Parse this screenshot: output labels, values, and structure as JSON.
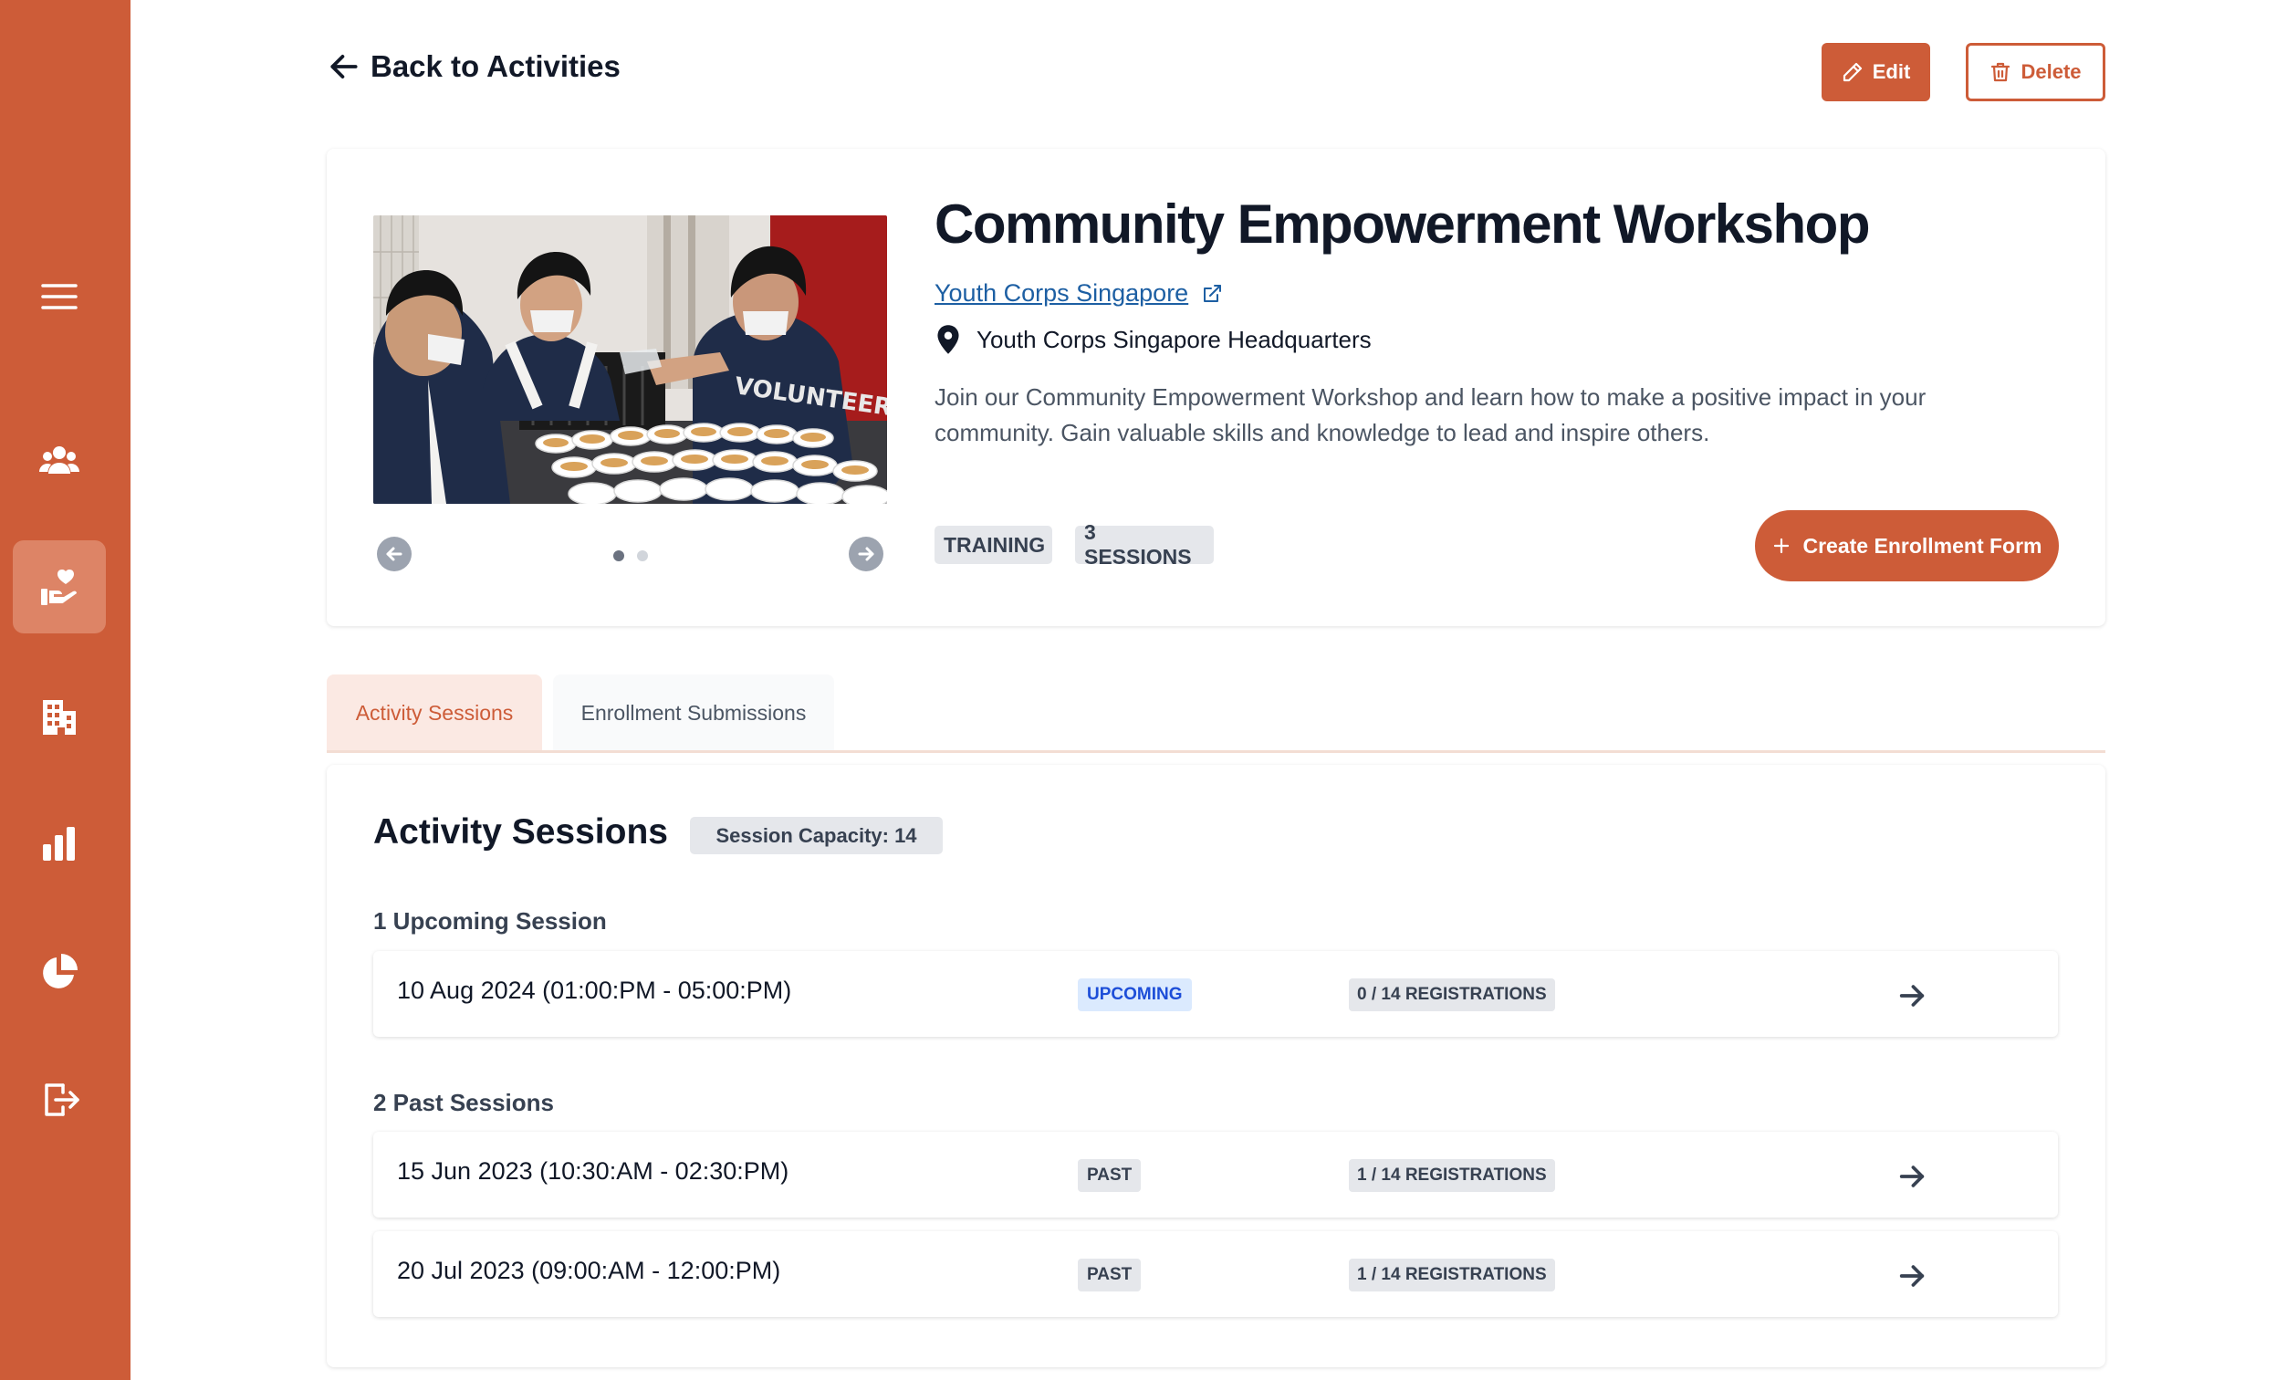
{
  "nav": {
    "items": [
      {
        "icon": "menu-icon"
      },
      {
        "icon": "users-icon"
      },
      {
        "icon": "volunteer-icon",
        "active": true
      },
      {
        "icon": "building-icon"
      },
      {
        "icon": "bar-chart-icon"
      },
      {
        "icon": "pie-chart-icon"
      },
      {
        "icon": "logout-icon"
      }
    ]
  },
  "header": {
    "back_label": "Back to Activities",
    "edit_label": "Edit",
    "delete_label": "Delete"
  },
  "activity": {
    "title": "Community Empowerment Workshop",
    "organization": "Youth Corps Singapore",
    "location": "Youth Corps Singapore Headquarters",
    "description": "Join our Community Empowerment Workshop and learn how to make a positive impact in your community. Gain valuable skills and knowledge to lead and inspire others.",
    "tags": [
      "TRAINING",
      "3 SESSIONS"
    ],
    "create_button": "Create Enrollment Form",
    "carousel": {
      "image_count": 2,
      "current": 1,
      "image_text": "VOLUNTEER"
    }
  },
  "tabs": [
    {
      "label": "Activity Sessions",
      "active": true
    },
    {
      "label": "Enrollment Submissions",
      "active": false
    }
  ],
  "sessions": {
    "title": "Activity Sessions",
    "capacity_label": "Session Capacity: 14",
    "upcoming_label": "1 Upcoming Session",
    "past_label": "2 Past Sessions",
    "upcoming": [
      {
        "date": "10 Aug 2024 (01:00:PM - 05:00:PM)",
        "status": "UPCOMING",
        "registrations": "0 / 14 REGISTRATIONS"
      }
    ],
    "past": [
      {
        "date": "15 Jun 2023 (10:30:AM - 02:30:PM)",
        "status": "PAST",
        "registrations": "1 / 14 REGISTRATIONS"
      },
      {
        "date": "20 Jul 2023 (09:00:AM - 12:00:PM)",
        "status": "PAST",
        "registrations": "1 / 14 REGISTRATIONS"
      }
    ]
  },
  "colors": {
    "brand": "#cd5c38",
    "brand_light": "#fbe9e3",
    "link": "#1d5fa3",
    "upcoming_bg": "#dbeafe",
    "upcoming_text": "#1d4ed8"
  }
}
